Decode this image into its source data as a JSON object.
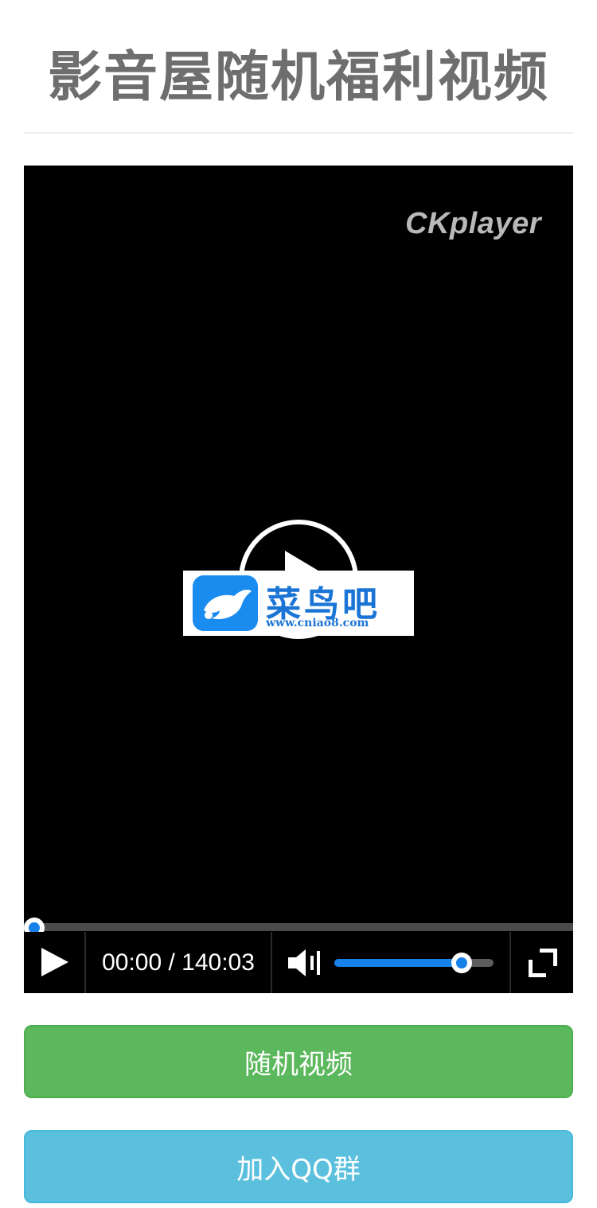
{
  "page": {
    "title": "影音屋随机福利视频"
  },
  "player": {
    "logo_text": "CKplayer",
    "watermark": {
      "name": "菜鸟吧",
      "url": "www.cniao8.com"
    },
    "progress_fraction": 0.0,
    "time_display": "00:00 / 140:03",
    "volume_fraction": 0.8,
    "accent_color": "#1781ea",
    "icons": {
      "play": "play-icon",
      "volume": "volume-icon",
      "fullscreen": "fullscreen-icon",
      "big_play": "big-play-icon"
    }
  },
  "buttons": {
    "random_video_label": "随机视频",
    "random_video_color": "#5cb85c",
    "join_qq_label": "加入QQ群",
    "join_qq_color": "#5bc0de"
  }
}
